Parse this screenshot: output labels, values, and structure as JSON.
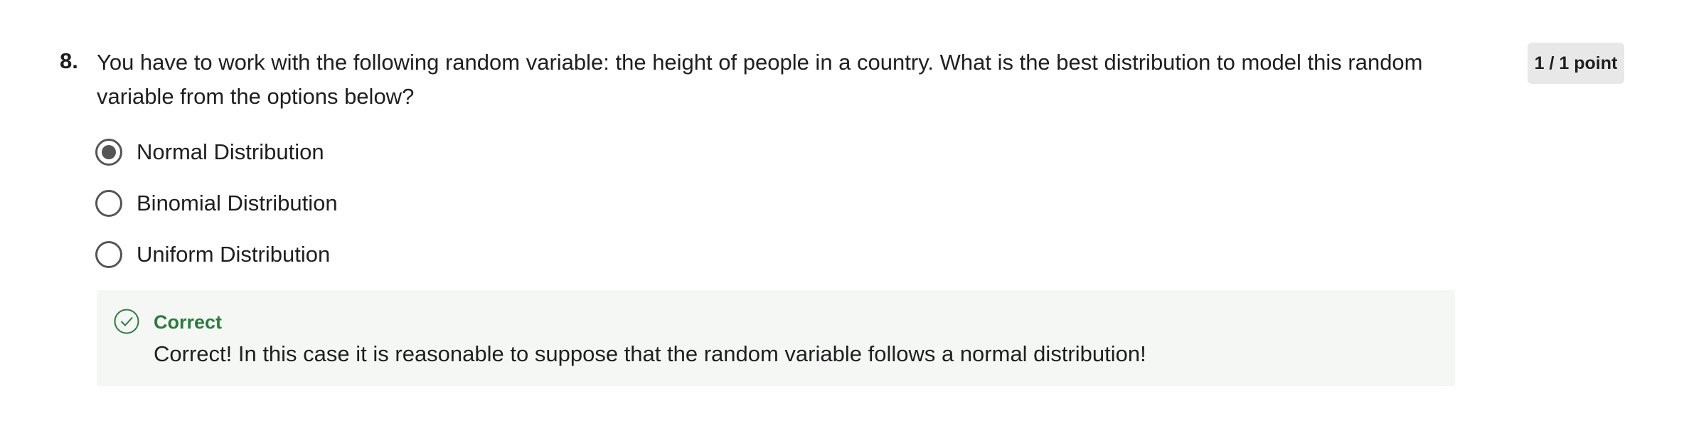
{
  "question": {
    "number": "8.",
    "text": "You have to work with the following random variable: the height of people in a country. What is the best distribution to model this random variable from the options below?",
    "points": "1 / 1 point"
  },
  "options": [
    {
      "label": "Normal Distribution",
      "selected": true
    },
    {
      "label": "Binomial Distribution",
      "selected": false
    },
    {
      "label": "Uniform Distribution",
      "selected": false
    }
  ],
  "feedback": {
    "icon": "check-circle-icon",
    "title": "Correct",
    "text": "Correct! In this case it is reasonable to suppose that the random variable follows a normal distribution!",
    "color": "#2d7a3e"
  }
}
